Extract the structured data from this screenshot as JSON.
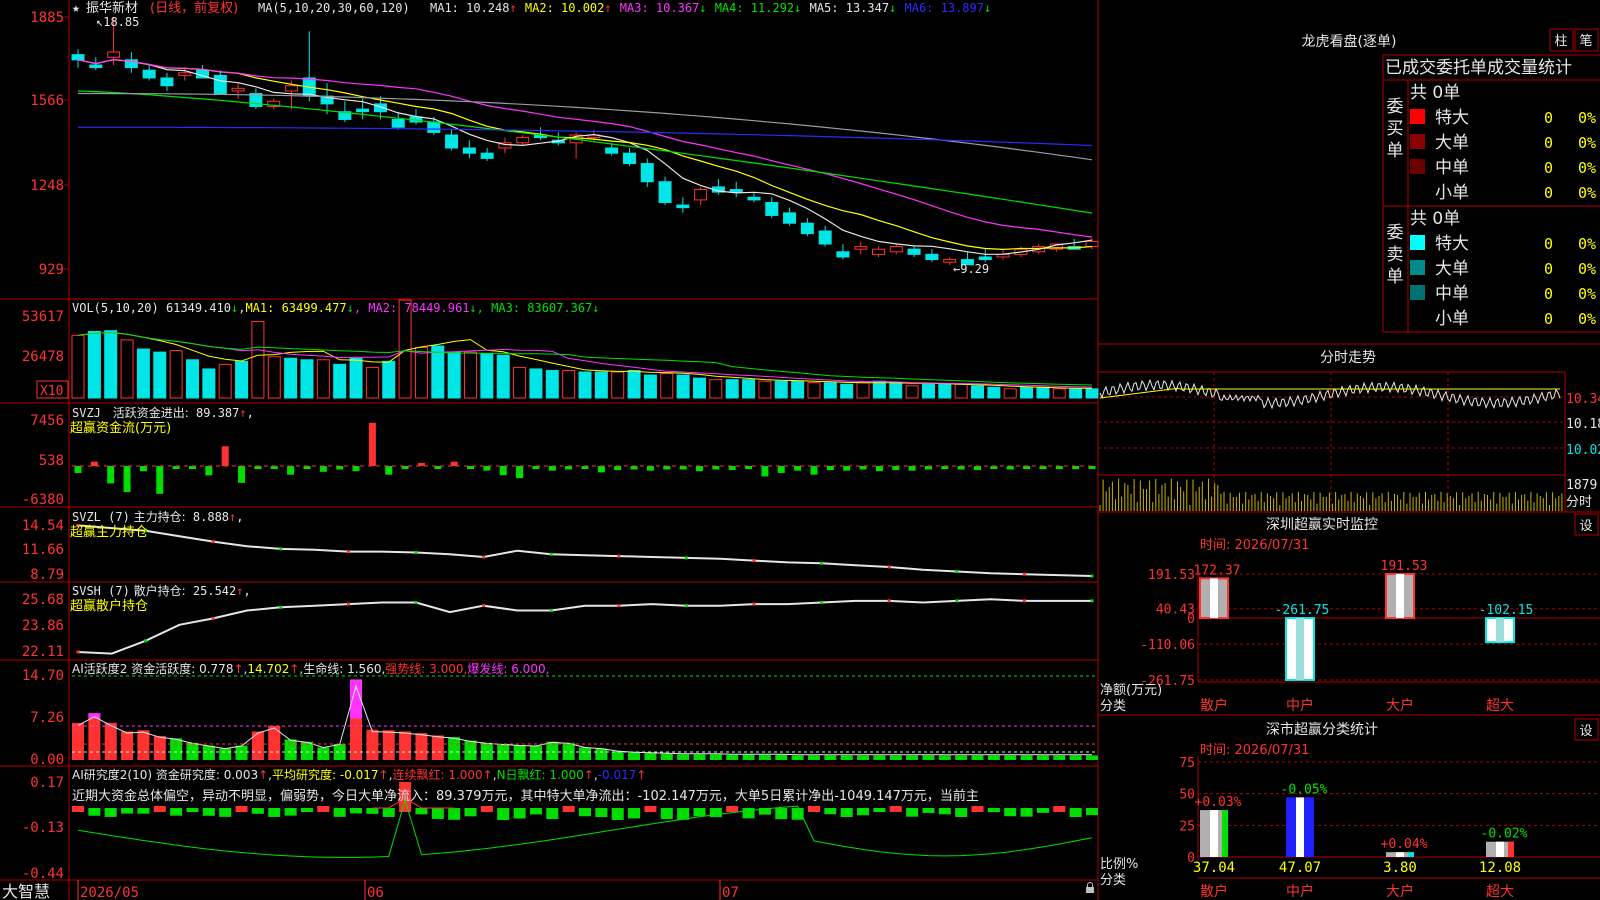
{
  "colors": {
    "up": "#ff3232",
    "down": "#00e5e5",
    "grid": "#b00000",
    "label": "#ff3232",
    "white": "#e6e6e6",
    "yellow": "#ffff00",
    "magenta": "#ff33ff",
    "green": "#00e000",
    "blue": "#2b2bff",
    "gray": "#9a9aa8",
    "barGreen": "#00dd00"
  },
  "stock": {
    "name": "振华新材",
    "period": "(日线，前复权)",
    "star": "★",
    "high_note": "18.85",
    "low_note": "9.29"
  },
  "ma": {
    "title": "MA(5,10,20,30,60,120)",
    "items": [
      {
        "label": "MA1:",
        "value": "10.248",
        "arrow": "↑",
        "color": "#e6e6e6"
      },
      {
        "label": "MA2:",
        "value": "10.002",
        "arrow": "↑",
        "color": "#ffff00"
      },
      {
        "label": "MA3:",
        "value": "10.367",
        "arrow": "↓",
        "color": "#ff33ff"
      },
      {
        "label": "MA4:",
        "value": "11.292",
        "arrow": "↓",
        "color": "#00e000"
      },
      {
        "label": "MA5:",
        "value": "13.347",
        "arrow": "↓",
        "color": "#e6e6e6"
      },
      {
        "label": "MA6:",
        "value": "13.897",
        "arrow": "↓",
        "color": "#2b2bff"
      }
    ]
  },
  "price_axis": [
    "1885",
    "1566",
    "1248",
    "929"
  ],
  "vol": {
    "title": "VOL(5,10,20)",
    "value": "61349.410",
    "arrow": "↓",
    "ma1": "63499.477",
    "ma2": "78449.961",
    "ma3": "83607.367",
    "axis": [
      "53617",
      "26478"
    ],
    "unit": "X10"
  },
  "svzj": {
    "title": "SVZJ",
    "label": "活跃资金进出:",
    "value": "89.387",
    "arrow": "↑",
    "sub": "超赢资金流(万元)",
    "axis": [
      "7456",
      "538",
      "-6380"
    ]
  },
  "svzl": {
    "title": "SVZL (7)",
    "label": "主力持仓:",
    "value": "8.888",
    "arrow": "↑",
    "sub": "超赢主力持仓",
    "axis": [
      "14.54",
      "11.66",
      "8.79"
    ]
  },
  "svsh": {
    "title": "SVSH (7)",
    "label": "散户持仓:",
    "value": "25.542",
    "arrow": "↑",
    "sub": "超赢散户持仓",
    "axis": [
      "25.68",
      "23.86",
      "22.11"
    ]
  },
  "ai2": {
    "title": "AI活跃度2",
    "l1": "资金活跃度:",
    "v1": "0.778",
    "v2": "14.702",
    "l3": "生命线:",
    "v3": "1.560",
    "l4": "强势线:",
    "v4": "3.000",
    "l5": "爆发线:",
    "v5": "6.000",
    "axis": [
      "14.70",
      "7.26",
      "0.00"
    ]
  },
  "ai_r": {
    "title": "AI研究度2(10)",
    "l1": "资金研究度:",
    "v1": "0.003",
    "l2": "平均研究度:",
    "v2": "-0.017",
    "l3": "连续飘红:",
    "v3": "1.000",
    "l4": "N日飘红:",
    "v4": "1.000",
    "v5": "-0.017",
    "axis": [
      "0.17",
      "-0.13",
      "-0.44"
    ]
  },
  "comment": "近期大资金总体偏空，异动不明显，偏弱势，今日大单净流入：89.379万元，其中特大单净流出：-102.147万元，大单5日累计净出-1049.147万元，当前主",
  "dates": [
    "2026/05",
    "06",
    "07"
  ],
  "brand": "大智慧",
  "lhb": {
    "title": "龙虎看盘(逐单)",
    "btn1": "柱",
    "btn2": "笔",
    "header": "已成交委托单成交量统计",
    "buy_side": "委买单",
    "sell_side": "委卖单",
    "total": "共 0单",
    "rows": [
      "特大",
      "大单",
      "中单",
      "小单"
    ],
    "count": "0",
    "pct": "0%",
    "buy_colors": [
      "#ff0000",
      "#8b0000",
      "#6b0000",
      "#000000"
    ],
    "sell_colors": [
      "#00ffff",
      "#008b8b",
      "#007070",
      "#000000"
    ]
  },
  "fs": {
    "title": "分时走势",
    "axis": [
      "10.34",
      "10.18",
      "10.02"
    ],
    "vol": "1879",
    "vol_unit": "分时"
  },
  "monitor": {
    "title": "深圳超赢实时监控",
    "btn": "设",
    "time": "时间: 2026/07/31",
    "axis": [
      "191.53",
      "40.43",
      "0",
      "-110.06",
      "-261.75"
    ],
    "y_title": "净额(万元)",
    "x_title": "分类",
    "cats": [
      "散户",
      "中户",
      "大户",
      "超大"
    ],
    "values": [
      172.37,
      -261.75,
      191.53,
      -102.15
    ],
    "labels": [
      "172.37",
      "-261.75",
      "191.53",
      "-102.15"
    ]
  },
  "stats": {
    "title": "深市超赢分类统计",
    "btn": "设",
    "time": "时间: 2026/07/31",
    "axis": [
      "75",
      "50",
      "25",
      "0"
    ],
    "y_title": "比例%",
    "x_title": "分类",
    "cats": [
      "散户",
      "中户",
      "大户",
      "超大"
    ],
    "values": [
      37.04,
      47.07,
      3.8,
      12.08
    ],
    "changes": [
      "+0.03%",
      "-0.05%",
      "+0.04%",
      "-0.02%"
    ],
    "labels": [
      "37.04",
      "47.07",
      "3.80",
      "12.08"
    ]
  },
  "chart_data": [
    {
      "type": "candlestick",
      "title": "振华新材(日线，前复权)",
      "ylim": [
        9.29,
        18.85
      ],
      "ohlc": [
        [
          17.4,
          17.6,
          16.9,
          17.2
        ],
        [
          17.0,
          17.3,
          16.8,
          16.9
        ],
        [
          17.3,
          18.85,
          17.0,
          17.5
        ],
        [
          17.2,
          17.5,
          16.7,
          16.9
        ],
        [
          16.8,
          17.0,
          16.4,
          16.5
        ],
        [
          16.5,
          16.7,
          16.0,
          16.2
        ],
        [
          16.6,
          16.9,
          16.4,
          16.7
        ],
        [
          16.8,
          17.0,
          16.6,
          16.5
        ],
        [
          16.6,
          16.8,
          15.9,
          15.9
        ],
        [
          16.0,
          16.3,
          15.7,
          16.1
        ],
        [
          15.9,
          16.1,
          15.3,
          15.4
        ],
        [
          15.4,
          15.7,
          15.3,
          15.6
        ],
        [
          16.0,
          16.4,
          15.3,
          16.2
        ],
        [
          16.5,
          18.3,
          15.6,
          15.8
        ],
        [
          15.8,
          16.3,
          15.1,
          15.5
        ],
        [
          15.2,
          15.6,
          14.8,
          14.9
        ],
        [
          15.3,
          15.7,
          14.9,
          15.2
        ],
        [
          15.5,
          15.8,
          14.9,
          15.2
        ],
        [
          14.9,
          15.2,
          14.5,
          14.6
        ],
        [
          15.0,
          15.3,
          14.7,
          14.8
        ],
        [
          14.8,
          15.0,
          14.3,
          14.4
        ],
        [
          14.3,
          14.5,
          13.7,
          13.8
        ],
        [
          13.8,
          14.1,
          13.4,
          13.6
        ],
        [
          13.6,
          13.8,
          13.3,
          13.4
        ],
        [
          13.8,
          14.2,
          13.6,
          14.0
        ],
        [
          14.0,
          14.3,
          13.9,
          14.2
        ],
        [
          14.3,
          14.6,
          14.1,
          14.2
        ],
        [
          14.1,
          14.4,
          13.9,
          14.0
        ],
        [
          14.0,
          14.4,
          13.4,
          14.3
        ],
        [
          14.2,
          14.5,
          14.0,
          14.3
        ],
        [
          13.8,
          14.0,
          13.5,
          13.6
        ],
        [
          13.6,
          13.8,
          13.1,
          13.2
        ],
        [
          13.2,
          13.4,
          12.3,
          12.5
        ],
        [
          12.5,
          12.7,
          11.6,
          11.7
        ],
        [
          11.6,
          11.9,
          11.3,
          11.5
        ],
        [
          11.8,
          12.3,
          11.6,
          12.2
        ],
        [
          12.3,
          12.6,
          12.0,
          12.1
        ],
        [
          12.2,
          12.5,
          11.9,
          12.1
        ],
        [
          11.9,
          12.1,
          11.7,
          11.8
        ],
        [
          11.7,
          11.9,
          11.1,
          11.2
        ],
        [
          11.3,
          11.5,
          10.8,
          10.9
        ],
        [
          10.9,
          11.1,
          10.4,
          10.5
        ],
        [
          10.6,
          10.8,
          10.0,
          10.1
        ],
        [
          9.8,
          10.1,
          9.5,
          9.6
        ],
        [
          9.9,
          10.2,
          9.7,
          10.0
        ],
        [
          9.7,
          10.0,
          9.6,
          9.9
        ],
        [
          9.8,
          10.1,
          9.7,
          10.0
        ],
        [
          9.9,
          10.0,
          9.6,
          9.7
        ],
        [
          9.7,
          9.9,
          9.4,
          9.5
        ],
        [
          9.4,
          9.6,
          9.29,
          9.5
        ],
        [
          9.5,
          9.8,
          9.3,
          9.3
        ],
        [
          9.6,
          9.9,
          9.4,
          9.5
        ],
        [
          9.6,
          9.9,
          9.5,
          9.7
        ],
        [
          9.7,
          10.0,
          9.6,
          9.9
        ],
        [
          9.8,
          10.1,
          9.7,
          10.0
        ],
        [
          9.9,
          10.1,
          9.8,
          10.1
        ],
        [
          10.0,
          10.3,
          9.9,
          9.9
        ],
        [
          10.0,
          10.3,
          9.9,
          10.2
        ]
      ],
      "ma1_last": 10.248,
      "ma2_last": 10.002,
      "ma3_last": 10.367,
      "ma4_last": 11.292,
      "ma5_last": 13.347,
      "ma6_last": 13.897
    },
    {
      "type": "bar",
      "title": "VOL(5,10,20)",
      "ylim": [
        0,
        53617
      ],
      "values": [
        41000,
        43500,
        44000,
        38000,
        32000,
        30000,
        31000,
        25000,
        19000,
        22000,
        24000,
        50000,
        27000,
        26000,
        25000,
        25000,
        22000,
        26000,
        20000,
        24000,
        64000,
        33000,
        34000,
        30000,
        30000,
        29000,
        28000,
        20000,
        19000,
        18000,
        18000,
        17000,
        17000,
        17000,
        18000,
        15000,
        16000,
        15000,
        13000,
        12000,
        12000,
        12000,
        11000,
        11000,
        11000,
        10000,
        10000,
        9000,
        10000,
        11000,
        10000,
        8000,
        9000,
        9000,
        9000,
        8000,
        7000,
        6000,
        7000,
        7000,
        6000,
        6000,
        6000
      ],
      "last": 61349.41
    },
    {
      "type": "bar",
      "title": "SVZJ 活跃资金进出",
      "ylim": [
        -6380,
        7456
      ],
      "values": [
        -1200,
        700,
        -3000,
        -4500,
        -900,
        -4800,
        -300,
        -300,
        -1600,
        3200,
        -2900,
        -100,
        -300,
        -1500,
        -400,
        -1000,
        -600,
        -900,
        7000,
        -1500,
        -100,
        500,
        -100,
        700,
        -300,
        -800,
        -1600,
        -2100,
        -400,
        -800,
        -600,
        -500,
        -1100,
        -700,
        -600,
        -800,
        -600,
        -600,
        -900,
        -600,
        -700,
        -500,
        -1800,
        -1200,
        -800,
        -1500,
        -700,
        -800,
        -600,
        -900,
        -700,
        -800,
        -600,
        -500,
        -600,
        -700,
        -500,
        -600,
        -400,
        -500,
        -400,
        -400,
        -300
      ],
      "last": 89.387
    },
    {
      "type": "line",
      "title": "SVZL (7) 主力持仓",
      "ylim": [
        8.79,
        14.54
      ],
      "values": [
        14.5,
        14.2,
        13.9,
        13.3,
        12.7,
        12.2,
        11.9,
        11.8,
        11.6,
        11.6,
        11.5,
        11.3,
        11.0,
        11.7,
        11.3,
        11.2,
        11.1,
        11.0,
        10.9,
        10.8,
        10.6,
        10.4,
        10.3,
        10.1,
        9.9,
        9.6,
        9.4,
        9.2,
        9.1,
        9.0,
        8.9
      ],
      "last": 8.888
    },
    {
      "type": "line",
      "title": "SVSH (7) 散户持仓",
      "ylim": [
        22.11,
        25.68
      ],
      "values": [
        22.3,
        22.2,
        23.0,
        24.0,
        24.4,
        24.9,
        25.1,
        25.2,
        25.3,
        25.4,
        25.4,
        24.8,
        25.2,
        24.9,
        24.9,
        25.2,
        25.2,
        25.3,
        25.2,
        25.2,
        25.3,
        25.3,
        25.4,
        25.5,
        25.5,
        25.4,
        25.5,
        25.6,
        25.5,
        25.5,
        25.5
      ],
      "last": 25.542
    },
    {
      "type": "bar",
      "title": "AI活跃度2",
      "ylim": [
        0,
        14.7
      ],
      "values": [
        6.5,
        8.2,
        6.5,
        5.0,
        5.2,
        4.2,
        3.8,
        3.0,
        2.5,
        2.0,
        2.5,
        5.0,
        6.0,
        3.6,
        3.2,
        2.2,
        2.8,
        14.1,
        5.3,
        5.2,
        5.0,
        4.7,
        4.3,
        4.0,
        3.4,
        3.0,
        2.8,
        2.6,
        2.5,
        3.2,
        3.0,
        2.2,
        2.0,
        1.5,
        1.3,
        1.2,
        1.1,
        1.0,
        1.0,
        1.0,
        0.9,
        0.9,
        0.9,
        0.9,
        0.8,
        0.8,
        0.8,
        0.8,
        0.8,
        0.8,
        0.8,
        0.8,
        0.8,
        0.8,
        0.8,
        0.8,
        0.8,
        0.8,
        0.8,
        0.8,
        0.8,
        0.8,
        0.8
      ],
      "last": 0.778
    },
    {
      "type": "bar",
      "title": "AI研究度2(10)",
      "ylim": [
        -0.44,
        0.17
      ],
      "last": 0.003,
      "avg": -0.017
    },
    {
      "type": "bar",
      "title": "深圳超赢实时监控",
      "categories": [
        "散户",
        "中户",
        "大户",
        "超大"
      ],
      "values": [
        172.37,
        -261.75,
        191.53,
        -102.15
      ],
      "ylim": [
        -261.75,
        191.53
      ]
    },
    {
      "type": "bar",
      "title": "深市超赢分类统计",
      "categories": [
        "散户",
        "中户",
        "大户",
        "超大"
      ],
      "values": [
        37.04,
        47.07,
        3.8,
        12.08
      ],
      "ylim": [
        0,
        75
      ]
    }
  ]
}
